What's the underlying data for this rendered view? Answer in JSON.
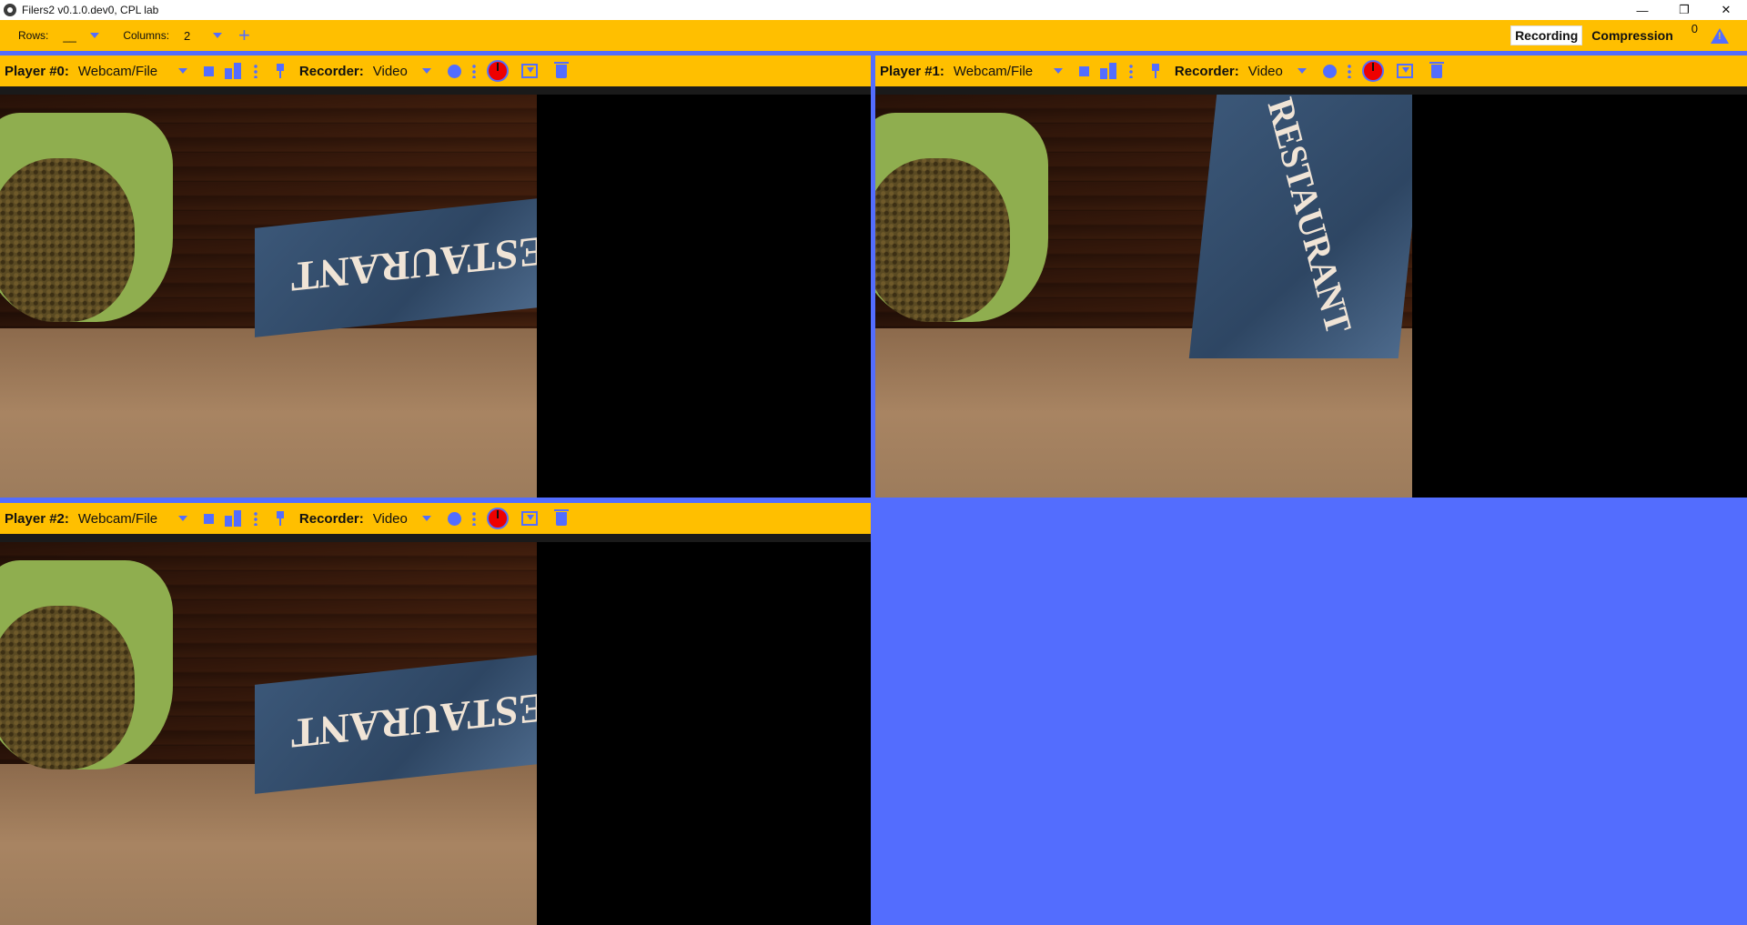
{
  "window": {
    "title": "Filers2 v0.1.0.dev0, CPL lab",
    "controls": [
      "—",
      "❐",
      "✕"
    ]
  },
  "toolbar": {
    "rows_label": "Rows:",
    "rows_value": "__",
    "columns_label": "Columns:",
    "columns_value": "2",
    "add_label": "+",
    "recording_label": "Recording",
    "compression_label": "Compression",
    "count": "0"
  },
  "players": [
    {
      "player_label": "Player #0:",
      "source": "Webcam/File",
      "recorder_label": "Recorder:",
      "recorder": "Video",
      "bag_text": "RESTAURANT"
    },
    {
      "player_label": "Player #1:",
      "source": "Webcam/File",
      "recorder_label": "Recorder:",
      "recorder": "Video",
      "bag_text": "RESTAURANT"
    },
    {
      "player_label": "Player #2:",
      "source": "Webcam/File",
      "recorder_label": "Recorder:",
      "recorder": "Video",
      "bag_text": "RESTAURANT"
    }
  ],
  "colors": {
    "accent": "#ffbf00",
    "primary": "#536dfe",
    "record": "#ee0000"
  }
}
